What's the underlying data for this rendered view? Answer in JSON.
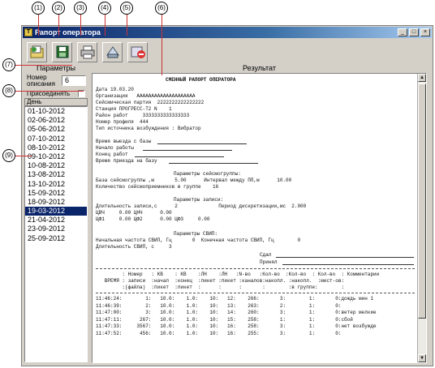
{
  "callouts": [
    "(1)",
    "(2)",
    "(3)",
    "(4)",
    "(5)",
    "(6)",
    "(7)",
    "(8)",
    "(9)"
  ],
  "window": {
    "title": "Рапорт оператора",
    "controls": [
      "_",
      "□",
      "×"
    ]
  },
  "toolbar": {
    "icons": [
      "open-icon",
      "save-icon",
      "print-icon",
      "archive-icon",
      "delete-icon"
    ]
  },
  "left_panel": {
    "title": "Параметры",
    "number_label_1": "Номер",
    "number_label_2": "описания",
    "number_value": "6",
    "attach_label": "Присоединять",
    "day_header": "День",
    "days": [
      "01-10-2012",
      "02-06-2012",
      "05-06-2012",
      "07-10-2012",
      "08-10-2012",
      "09-10-2012",
      "10-08-2012",
      "13-08-2012",
      "13-10-2012",
      "15-09-2012",
      "18-09-2012",
      "19-03-2012",
      "21-04-2012",
      "23-09-2012",
      "25-09-2012"
    ],
    "selected_day": "19-03-2012"
  },
  "right_panel": {
    "title": "Результат"
  },
  "report": {
    "heading": "СМЕННЫЙ РАПОРТ ОПЕРАТОРА",
    "date": "Дата 19.03.20",
    "organization": "Организация   AAAAAAAAAAAAAAAAAAAA",
    "crew": "Сейсмическая партия  2222222222222222",
    "station": "Станция ПРОГРЕСС-Т2 N    1",
    "area": "Район работ     3333333333333333",
    "profile": "Номер профиля  444",
    "source": "Тип источника возбуждения : Вибратор",
    "time_out": "Время выезда с базы",
    "time_start": "Начало работы",
    "time_end": "Конец работ",
    "time_return": "Время приезда на базу",
    "seis_header": "Параметры сейсмогруппы:",
    "seis_base": "База сейсмогруппы ,м       5.00      Интервал между ПП,м      10.00",
    "seis_count": "Количество сейсмоприемников в группе    16",
    "rec_header": "Параметры записи:",
    "rec_duration": "Длительность записи,с      2              Период дискретизации,мс  2.000",
    "filters_1": "ЦВЧ     0.00 ЦНЧ      0.00",
    "filters_2": "ЦФ1     0.00 ЦФ2      0.00 ЦФ3     0.00",
    "swip_header": "Параметры СВИП:",
    "swip_freq": "Начальная частота СВИП, Гц       0  Конечная частота СВИП, Гц        0",
    "swip_dur": "Длительность СВИП, с     3",
    "handed": "Сдал",
    "received": "Принял",
    "table_header_1": "         : Номер   : КВ    : КВ    :ЛН    :ЛН   :N-во   :Кол-во  :Кол-во  : Кол-во  : Комментарии",
    "table_header_2": "   ВРЕМЯ : записи  :начал  :конец  :пикет :пикет :каналов:накопл. :накопл.  :мест-ов:",
    "table_header_3": "         :(файла)  :пикет  :пикет  :      :      :       :        :в группе:        :",
    "rows": [
      "11:46:24:        1:   10.0:    1.0:    10:   12:    266:       3:        1:       0:дождь мин 1",
      "11:46:39:        2:   10.0:    1.0:    10:   13:    263:       2:        1:       0:",
      "11:47:00:        3:   10.0:    1.0:    10:   14:    260:       3:        1:       0:ветер мелкие",
      "11:47:11:      267:   10.0:    1.0:    10:   15:    258:       1:        1:       0:сбой",
      "11:47:33:     3567:   10.0:    1.0:    10:   16:    258:       3:        1:       0:нет возбужде",
      "11:47:52:      456:   10.0:    1.0:    10:   16:    255:       3:        1:       0:"
    ]
  },
  "colors": {
    "title_bar": "#0a246a",
    "selection": "#0a246a",
    "callout_line": "#cc3333",
    "face": "#d4d0c8"
  }
}
